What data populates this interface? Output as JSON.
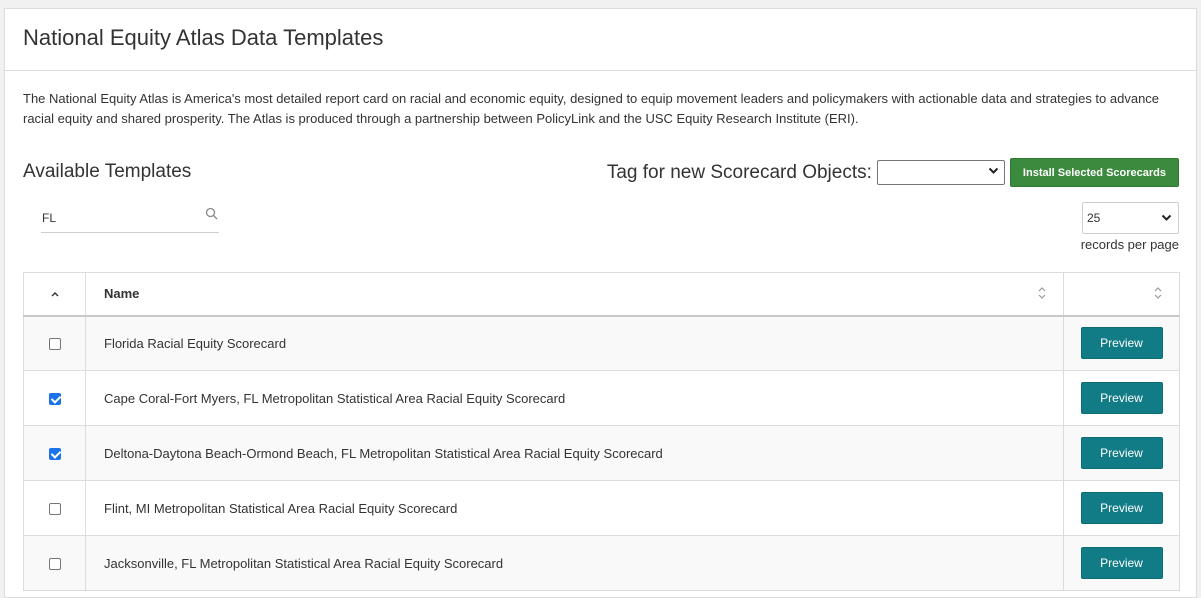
{
  "header": {
    "title": "National Equity Atlas Data Templates"
  },
  "description": "The National Equity Atlas is America's most detailed report card on racial and economic equity, designed to equip movement leaders and policymakers with actionable data and strategies to advance racial equity and shared prosperity. The Atlas is produced through a partnership between PolicyLink and the USC Equity Research Institute (ERI).",
  "templates": {
    "title": "Available Templates",
    "tag_label": "Tag for new Scorecard Objects:",
    "tag_value": "",
    "install_label": "Install Selected Scorecards",
    "search": {
      "value": "FL",
      "placeholder": ""
    },
    "page_size": {
      "value": "25",
      "label": "records per page"
    }
  },
  "table": {
    "columns": {
      "name": "Name"
    },
    "preview_label": "Preview",
    "rows": [
      {
        "name": "Florida Racial Equity Scorecard",
        "checked": false
      },
      {
        "name": "Cape Coral-Fort Myers, FL Metropolitan Statistical Area Racial Equity Scorecard",
        "checked": true
      },
      {
        "name": "Deltona-Daytona Beach-Ormond Beach, FL Metropolitan Statistical Area Racial Equity Scorecard",
        "checked": true
      },
      {
        "name": "Flint, MI Metropolitan Statistical Area Racial Equity Scorecard",
        "checked": false
      },
      {
        "name": "Jacksonville, FL Metropolitan Statistical Area Racial Equity Scorecard",
        "checked": false
      }
    ]
  },
  "colors": {
    "install_button": "#3b8a3e",
    "preview_button": "#117c86",
    "checkbox_checked": "#1a73e8"
  }
}
